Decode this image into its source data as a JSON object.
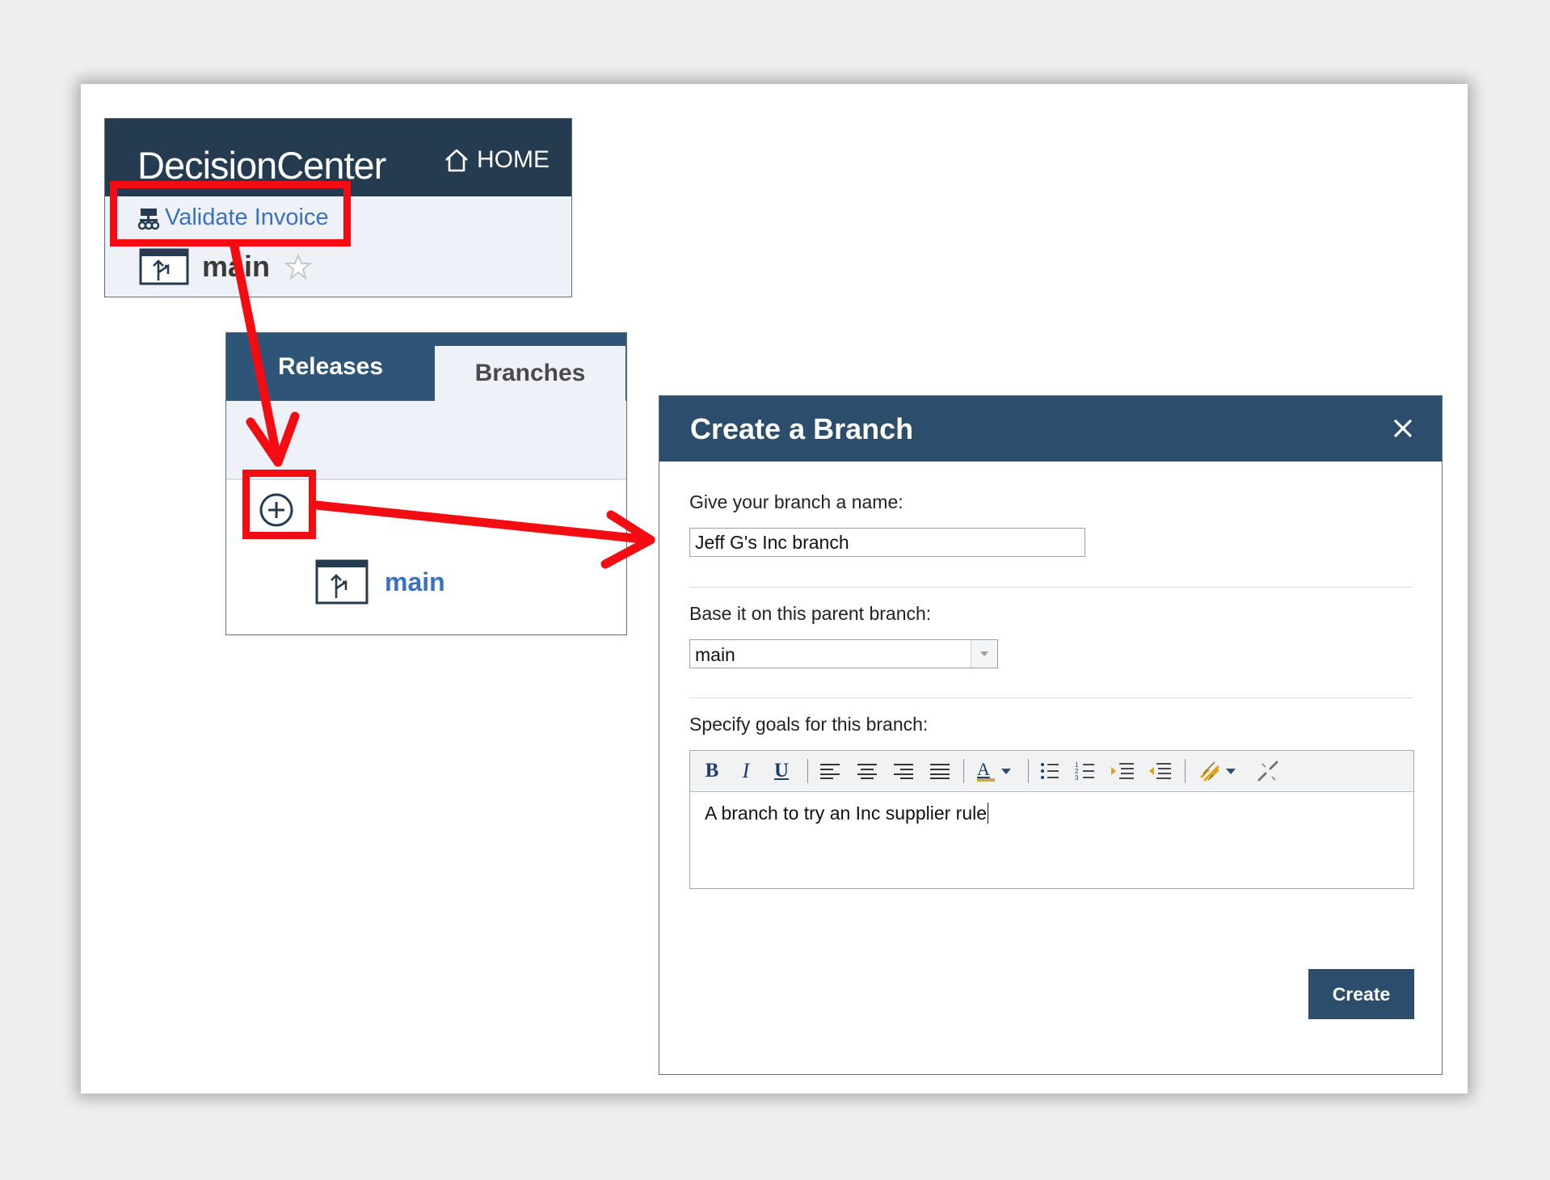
{
  "decision_center": {
    "title": "DecisionCenter",
    "home_label": "HOME",
    "project_link": "Validate Invoice",
    "branch_name": "main"
  },
  "branches_panel": {
    "tabs": [
      {
        "label": "Releases"
      },
      {
        "label": "Branches"
      }
    ],
    "items": [
      {
        "label": "main"
      }
    ]
  },
  "create_branch_dialog": {
    "title": "Create a Branch",
    "name_label": "Give your branch a name:",
    "name_value": "Jeff G's Inc branch",
    "parent_label": "Base it on this parent branch:",
    "parent_value": "main",
    "goals_label": "Specify goals for this branch:",
    "goals_text": "A branch to try an Inc supplier rule",
    "create_label": "Create"
  },
  "editor_toolbar": [
    "bold",
    "italic",
    "underline",
    "align-left",
    "align-center",
    "align-right",
    "align-justify",
    "font-color",
    "bullet-list",
    "numbered-list",
    "indent",
    "outdent",
    "insert-link",
    "remove-link"
  ],
  "colors": {
    "header_dark": "#243b50",
    "tab_blue": "#2e5477",
    "dialog_header": "#2c4d6b",
    "link_blue": "#3c72bd",
    "annotation_red": "#f30c12"
  }
}
